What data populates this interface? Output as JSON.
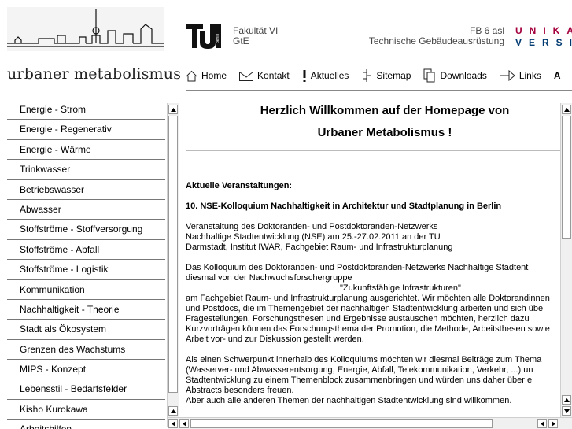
{
  "header": {
    "faculty_line1": "Fakultät VI",
    "faculty_line2": "GtE",
    "fb_line1": "FB 6 asl",
    "fb_line2": "Technische Gebäudeausrüstung",
    "unikassel_line1": "UNIKA",
    "unikassel_line2": "VERSI"
  },
  "site_title": "urbaner metabolismus",
  "nav": [
    {
      "label": "Home",
      "icon": "home-icon"
    },
    {
      "label": "Kontakt",
      "icon": "envelope-icon"
    },
    {
      "label": "Aktuelles",
      "icon": "exclamation-icon"
    },
    {
      "label": "Sitemap",
      "icon": "sitemap-icon"
    },
    {
      "label": "Downloads",
      "icon": "documents-icon"
    },
    {
      "label": "Links",
      "icon": "arrow-right-icon"
    },
    {
      "label": "A",
      "icon": ""
    }
  ],
  "sidebar": {
    "items": [
      "Energie - Strom",
      "Energie - Regenerativ",
      "Energie - Wärme",
      "Trinkwasser",
      "Betriebswasser",
      "Abwasser",
      "Stoffströme - Stoffversorgung",
      "Stoffströme - Abfall",
      "Stoffströme - Logistik",
      "Kommunikation",
      "Nachhaltigkeit - Theorie",
      "Stadt als Ökosystem",
      "Grenzen des Wachstums",
      "MIPS - Konzept",
      "Lebensstil - Bedarfsfelder",
      "Kisho Kurokawa",
      "Arbeitshilfen"
    ]
  },
  "content": {
    "welcome_line1": "Herzlich Willkommen auf der Homepage von",
    "welcome_line2": "Urbaner Metabolismus !",
    "section_heading": "Aktuelle Veranstaltungen:",
    "event_title": "10. NSE-Kolloquium Nachhaltigkeit in Architektur und Stadtplanung in Berlin",
    "intro": [
      "Veranstaltung des Doktoranden- und Postdoktoranden-Netzwerks",
      "Nachhaltige Stadtentwicklung (NSE) am 25.-27.02.2011 an der TU",
      "Darmstadt, Institut IWAR, Fachgebiet Raum- und Infrastrukturplanung"
    ],
    "para1": [
      "Das Kolloquium des Doktoranden- und Postdoktoranden-Netzwerks Nachhaltige Stadtent",
      "diesmal von der Nachwuchsforschergruppe",
      "\"Zukunftsfähige Infrastrukturen\"",
      "am Fachgebiet Raum- und Infrastrukturplanung ausgerichtet. Wir möchten alle Doktorandinnen",
      "und Postdocs, die im Themengebiet der nachhaltigen Stadtentwicklung arbeiten und sich übe",
      "Fragestellungen, Forschungsthesen und Ergebnisse austauschen möchten, herzlich dazu",
      "Kurzvorträgen können das Forschungsthema der Promotion, die Methode, Arbeitsthesen sowie",
      "Arbeit vor- und zur Diskussion gestellt werden."
    ],
    "para2": [
      "Als einen Schwerpunkt innerhalb des Kolloquiums möchten wir diesmal Beiträge zum Thema",
      "(Wasserver- und Abwasserentsorgung, Energie, Abfall, Telekommunikation, Verkehr, ...) un",
      "Stadtentwicklung zu einem Themenblock zusammenbringen und würden uns daher über e",
      "Abstracts besonders freuen.",
      "Aber auch alle anderen Themen der nachhaltigen Stadtentwicklung sind willkommen."
    ]
  },
  "colors": {
    "unikassel_red": "#a5003c",
    "unikassel_blue": "#003a70"
  }
}
